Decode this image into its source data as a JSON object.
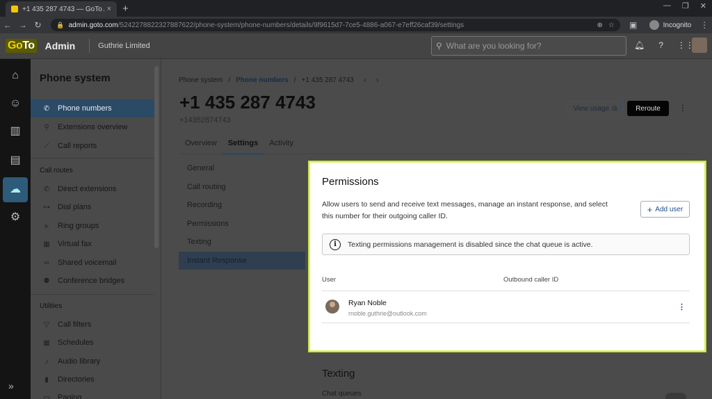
{
  "browser": {
    "tab_title": "+1 435 287 4743 — GoTo Admin",
    "tab_close": "×",
    "new_tab": "+",
    "window_controls": [
      "—",
      "❐",
      "✕"
    ],
    "url_host": "admin.goto.com",
    "url_path": "/5242278822327887622/phone-system/phone-numbers/details/9f9615d7-7ce5-4886-a067-e7eff26caf39/settings",
    "profile_label": "Incognito"
  },
  "header": {
    "logo_go": "Go",
    "logo_to": "To",
    "admin_label": "Admin",
    "company": "Guthrie Limited",
    "search_placeholder": "What are you looking for?"
  },
  "sidebar": {
    "title": "Phone system",
    "top_items": [
      {
        "label": "Phone numbers",
        "icon": "phone-icon"
      },
      {
        "label": "Extensions overview",
        "icon": "search-icon"
      },
      {
        "label": "Call reports",
        "icon": "chart-icon"
      }
    ],
    "call_routes_title": "Call routes",
    "call_routes": [
      {
        "label": "Direct extensions",
        "icon": "phone-forward-icon"
      },
      {
        "label": "Dial plans",
        "icon": "dial-plan-icon"
      },
      {
        "label": "Ring groups",
        "icon": "ring-groups-icon"
      },
      {
        "label": "Virtual fax",
        "icon": "fax-icon"
      },
      {
        "label": "Shared voicemail",
        "icon": "voicemail-icon"
      },
      {
        "label": "Conference bridges",
        "icon": "conference-icon"
      }
    ],
    "utilities_title": "Utilities",
    "utilities": [
      {
        "label": "Call filters",
        "icon": "filter-icon"
      },
      {
        "label": "Schedules",
        "icon": "calendar-icon"
      },
      {
        "label": "Audio library",
        "icon": "music-icon"
      },
      {
        "label": "Directories",
        "icon": "book-icon"
      },
      {
        "label": "Paging",
        "icon": "paging-icon"
      }
    ]
  },
  "main": {
    "breadcrumb": [
      "Phone system",
      "Phone numbers",
      "+1 435 287 4743"
    ],
    "title": "+1 435 287 4743",
    "subtitle": "+14352874743",
    "view_usage_label": "View usage",
    "reroute_label": "Reroute",
    "tabs": [
      "Overview",
      "Settings",
      "Activity"
    ],
    "settings_nav": [
      "General",
      "Call routing",
      "Recording",
      "Permissions",
      "Texting",
      "Instant Response"
    ],
    "texting_heading": "Texting",
    "chat_queues_label": "Chat queues"
  },
  "modal": {
    "title": "Permissions",
    "description": "Allow users to send and receive text messages, manage an instant response, and select this number for their outgoing caller ID.",
    "add_user_label": "Add user",
    "notice": "Texting permissions management is disabled since the chat queue is active.",
    "columns": [
      "User",
      "Outbound caller ID"
    ],
    "rows": [
      {
        "name": "Ryan Noble",
        "email": "rnoble.guthrie@outlook.com"
      }
    ]
  }
}
